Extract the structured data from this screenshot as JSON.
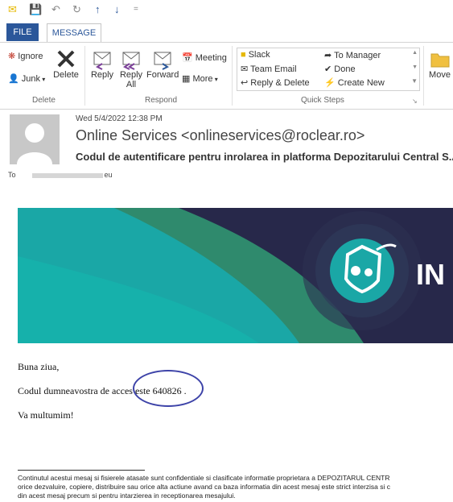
{
  "qat": {
    "icons": [
      "mail-icon",
      "save-icon",
      "undo-icon",
      "redo-icon",
      "up-arrow-icon",
      "down-arrow-icon",
      "customize-icon"
    ]
  },
  "tabs": {
    "file": "FILE",
    "message": "MESSAGE"
  },
  "ribbon": {
    "delete_group": {
      "ignore": "Ignore",
      "junk": "Junk",
      "delete": "Delete",
      "label": "Delete"
    },
    "respond_group": {
      "reply": "Reply",
      "reply_all_line1": "Reply",
      "reply_all_line2": "All",
      "forward": "Forward",
      "meeting": "Meeting",
      "more": "More",
      "label": "Respond"
    },
    "quick_steps": {
      "items": [
        "Slack",
        "Team Email",
        "Reply & Delete",
        "To Manager",
        "Done",
        "Create New"
      ],
      "label": "Quick Steps"
    },
    "move": "Move"
  },
  "message": {
    "date": "Wed 5/4/2022 12:38 PM",
    "sender": "Online Services <onlineservices@roclear.ro>",
    "subject": "Codul de autentificare pentru inrolarea in platforma Depozitarului Central S.A.",
    "to_label": "To",
    "to_suffix": "eu"
  },
  "banner": {
    "text": "IN",
    "colors": {
      "dark": "#27284a",
      "teal": "#1aa7a6",
      "green": "#2f8a6d"
    }
  },
  "body": {
    "greeting": "Buna ziua,",
    "code_prefix": "Codul dumneavostra de acces este",
    "code": "640826",
    "code_suffix": ".",
    "closing": "Va multumim!"
  },
  "disclaimer": {
    "line1": "Continutul acestui mesaj si fisierele atasate sunt confidentiale si clasificate informatie proprietara a DEPOZITARUL CENTR",
    "line2": "orice dezvaluire, copiere, distribuire sau orice alta actiune avand ca baza informatia din acest mesaj este strict interzisa si c",
    "line3": "din acest mesaj precum si pentru intarzierea in receptionarea mesajului."
  },
  "colors": {
    "accent": "#2b579a",
    "highlight_ellipse": "#3d43a8"
  }
}
